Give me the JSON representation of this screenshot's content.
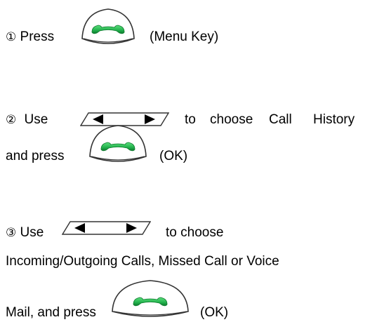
{
  "step1": {
    "num": "①",
    "press": "Press",
    "key_label": "(Menu Key)"
  },
  "step2": {
    "num": "②",
    "use": "Use",
    "w_to": "to",
    "w_choose": "choose",
    "w_call": "Call",
    "w_history": "History",
    "and_press": "and press",
    "ok": "(OK)"
  },
  "step3": {
    "num": "③",
    "use": "Use",
    "to_choose": "to choose",
    "line2": "Incoming/Outgoing Calls, Missed Call or Voice",
    "mail_press": "Mail, and press",
    "ok": "(OK)"
  },
  "icons": {
    "call_key": "green-phone-handset-key",
    "nav_key": "left-right-navigation-key"
  },
  "colors": {
    "handset_green": "#22b14c",
    "handset_dark": "#0e7a2e",
    "key_outline": "#333333"
  }
}
